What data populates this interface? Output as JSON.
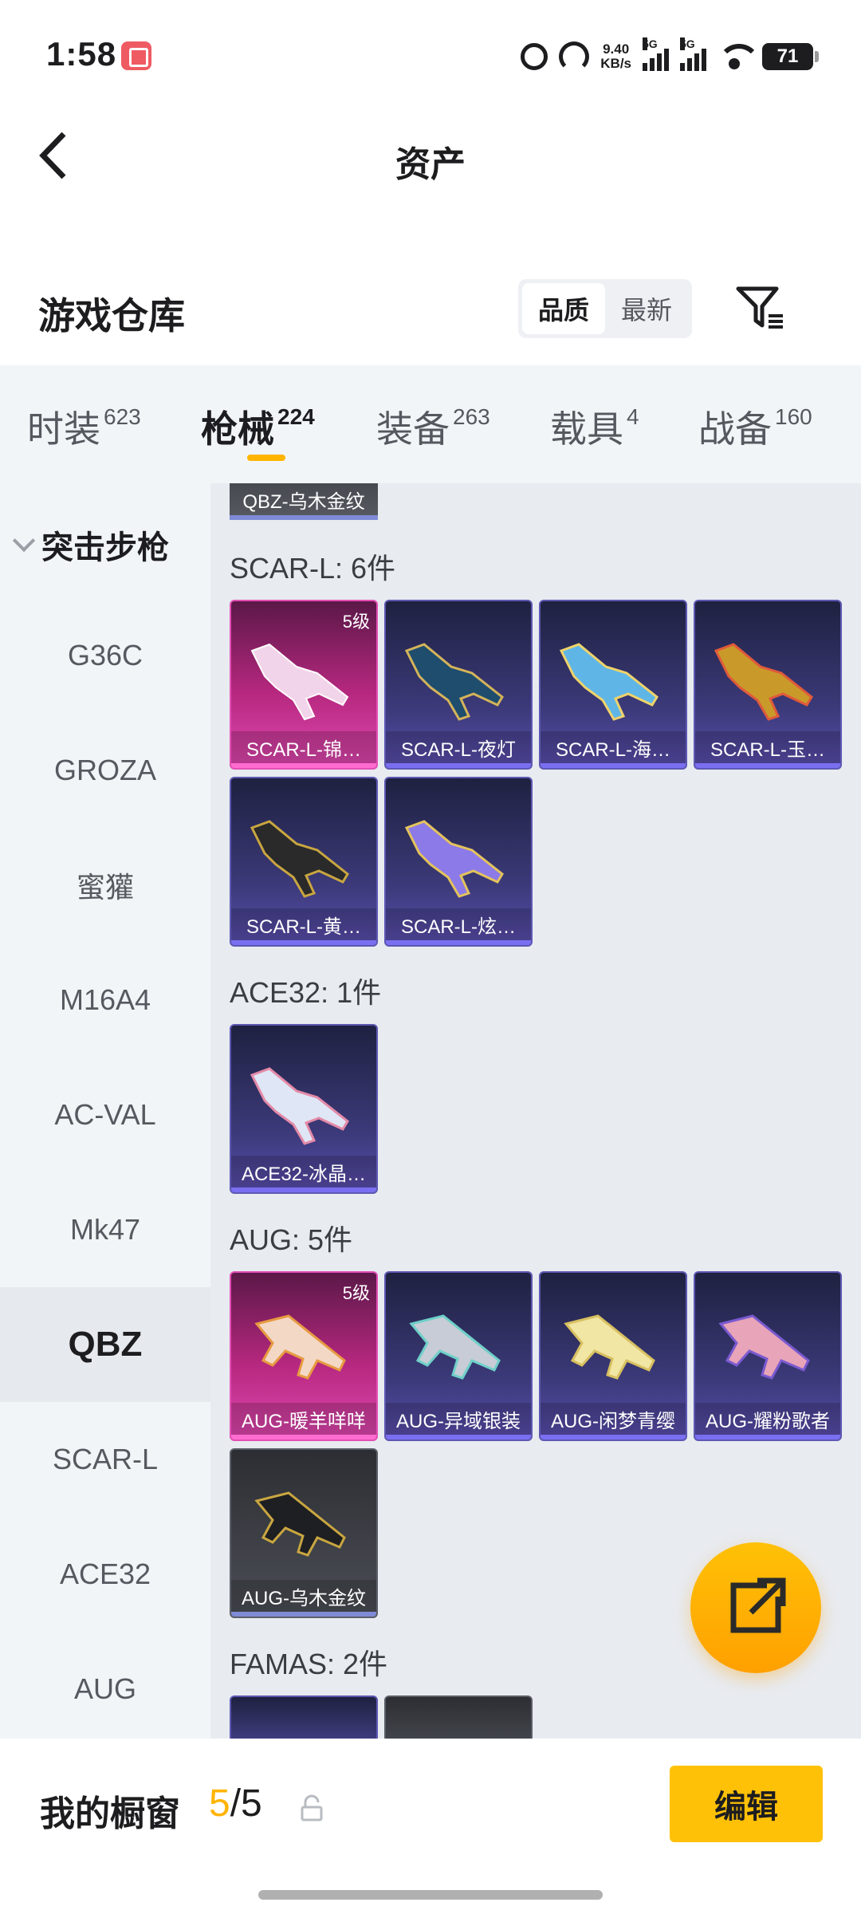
{
  "status_bar": {
    "time": "1:58",
    "speed_value": "9.40",
    "speed_unit": "KB/s",
    "network_1": "5G",
    "network_2": "5G",
    "battery": "71"
  },
  "header": {
    "title": "资产"
  },
  "warehouse": {
    "title": "游戏仓库",
    "sort_options": [
      "品质",
      "最新"
    ],
    "active_sort": "品质"
  },
  "tabs": [
    {
      "label": "时装",
      "count": "623"
    },
    {
      "label": "枪械",
      "count": "224",
      "active": true
    },
    {
      "label": "装备",
      "count": "263"
    },
    {
      "label": "载具",
      "count": "4"
    },
    {
      "label": "战备",
      "count": "160"
    }
  ],
  "sidebar": {
    "category": "突击步枪",
    "items": [
      "G36C",
      "GROZA",
      "蜜獾",
      "M16A4",
      "AC-VAL",
      "Mk47",
      "QBZ",
      "SCAR-L",
      "ACE32",
      "AUG"
    ],
    "active_item": "QBZ"
  },
  "main": {
    "partial_top_item": "QBZ-乌木金纹",
    "groups": [
      {
        "label": "SCAR-L: 6件",
        "items": [
          {
            "name": "SCAR-L-锦…",
            "level": "5级",
            "rarity": "pink"
          },
          {
            "name": "SCAR-L-夜灯",
            "rarity": "purple"
          },
          {
            "name": "SCAR-L-海…",
            "rarity": "purple"
          },
          {
            "name": "SCAR-L-玉…",
            "rarity": "purple"
          },
          {
            "name": "SCAR-L-黄…",
            "rarity": "purple"
          },
          {
            "name": "SCAR-L-炫…",
            "rarity": "purple"
          }
        ]
      },
      {
        "label": "ACE32: 1件",
        "items": [
          {
            "name": "ACE32-冰晶…",
            "rarity": "purple"
          }
        ]
      },
      {
        "label": "AUG: 5件",
        "items": [
          {
            "name": "AUG-暖羊咩咩",
            "level": "5级",
            "rarity": "pink"
          },
          {
            "name": "AUG-异域银装",
            "rarity": "purple"
          },
          {
            "name": "AUG-闲梦青缨",
            "rarity": "purple"
          },
          {
            "name": "AUG-耀粉歌者",
            "rarity": "purple"
          },
          {
            "name": "AUG-乌木金纹",
            "rarity": "grey"
          }
        ]
      },
      {
        "label": "FAMAS: 2件",
        "items": []
      }
    ]
  },
  "bottom": {
    "label": "我的橱窗",
    "count_current": "5",
    "count_separator": "/",
    "count_total": "5",
    "edit_label": "编辑"
  },
  "colors": {
    "accent": "#ffb400",
    "rarity_pink": "#e048b0",
    "rarity_purple": "#5b4fb0",
    "rarity_grey": "#4b4e55"
  }
}
